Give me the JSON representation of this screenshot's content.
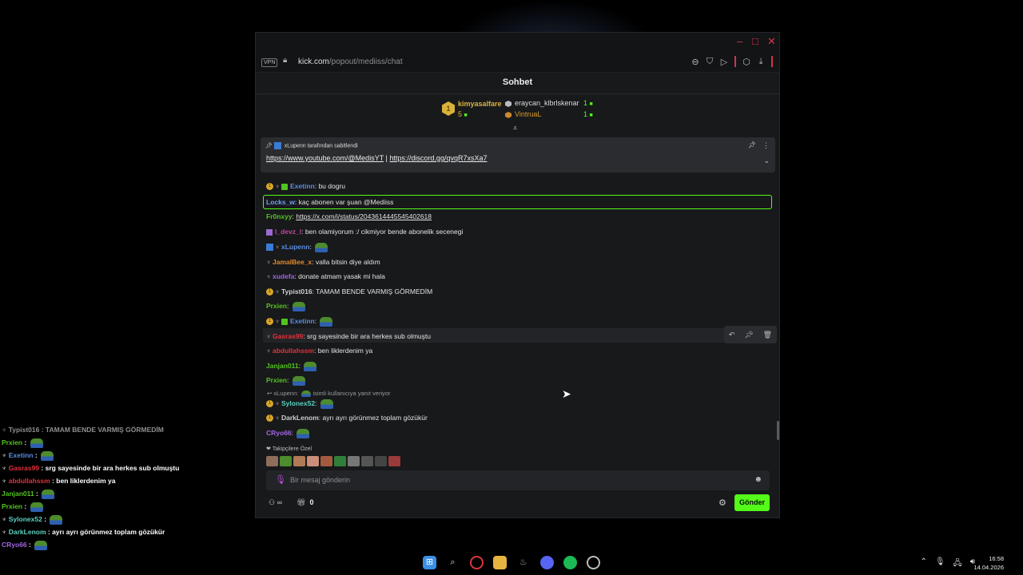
{
  "browser": {
    "vpn_label": "VPN",
    "url_host": "kick.com",
    "url_path": "/popout/mediiss/chat",
    "accent": "#d1344b"
  },
  "chat": {
    "title": "Sohbet",
    "leaderboard": {
      "first_rank": "1",
      "first_name": "kimyasalfare",
      "first_count": "5",
      "second_name": "eraycan_klbrlskenar",
      "second_count": "1",
      "third_name": "VintruaL",
      "third_count": "1"
    },
    "pinned": {
      "header": "xLupenn tarafından sabitlendi",
      "link1": "https://www.youtube.com/@MedisYT",
      "separator": "|",
      "link2": "https://discord.gg/qvqR7xsXa7"
    },
    "messages": [
      {
        "user": "Exetinn",
        "text": "bu dogru"
      },
      {
        "user": "Locks_w",
        "text": "kaç abonen var şuan @Mediiss"
      },
      {
        "user": "Fr0nxyy",
        "text": "https://x.com/i/status/2043614445545402618"
      },
      {
        "user": "l_devz_l",
        "text": "ben olamiyorum :/ cikmiyor bende abonelik secenegi"
      },
      {
        "user": "xLupenn",
        "text": ""
      },
      {
        "user": "JamalBee_x",
        "text": "valla bitsin diye aldım"
      },
      {
        "user": "xudefa",
        "text": "donate atmam yasak mi hala"
      },
      {
        "user": "Typist016",
        "text": "TAMAM BENDE VARMIŞ GÖRMEDİM"
      },
      {
        "user": "Prxien",
        "text": ""
      },
      {
        "user": "Exetinn",
        "text": ""
      },
      {
        "user": "Gasras99",
        "text": "srg sayesinde bir ara herkes sub olmuştu"
      },
      {
        "user": "abdullahssm",
        "text": "ben liklerdenim ya"
      },
      {
        "user": "Janjan011",
        "text": ""
      },
      {
        "user": "Prxien",
        "text": ""
      },
      {
        "user": "Sylonex52",
        "text": ""
      },
      {
        "user": "DarkLenom",
        "text": "ayrı ayrı görünmez toplam gözükür"
      },
      {
        "user": "CRyo66",
        "text": ""
      }
    ],
    "reply_context": "xLupenn:",
    "reply_suffix": "isimli kullanıcıya yanıt veriyor",
    "emote_section_title": "Takipçilere Özel",
    "input_placeholder": "Bir mesaj gönderin",
    "footer_count": "0",
    "send_label": "Gönder",
    "accent": "#53fc18"
  },
  "overlay": [
    {
      "user": "Typist016",
      "text": ": TAMAM BENDE VARMIŞ GÖRMEDİM"
    },
    {
      "user": "Prxien",
      "text": ":"
    },
    {
      "user": "Exetinn",
      "text": ":"
    },
    {
      "user": "Gasras99",
      "text": ": srg sayesinde bir ara herkes sub olmuştu"
    },
    {
      "user": "abdullahssm",
      "text": ": ben liklerdenim ya"
    },
    {
      "user": "Janjan011",
      "text": ":"
    },
    {
      "user": "Prxien",
      "text": ":"
    },
    {
      "user": "Sylonex52",
      "text": ":"
    },
    {
      "user": "DarkLenom",
      "text": ": ayrı ayrı görünmez toplam gözükür"
    },
    {
      "user": "CRyo66",
      "text": ":"
    }
  ],
  "taskbar": {
    "time": "16:58",
    "date": "14.04.2026"
  }
}
